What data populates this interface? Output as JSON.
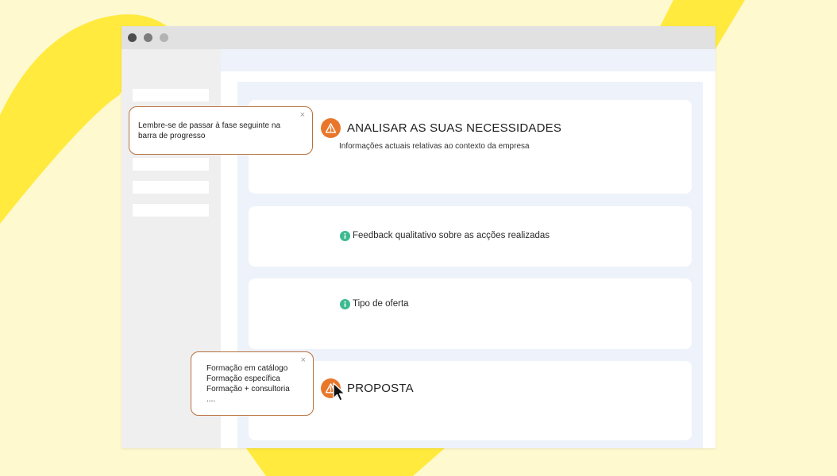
{
  "colors": {
    "background": "#fef9cf",
    "accent_yellow": "#ffea3d",
    "warning": "#e8772b",
    "info": "#3dba8f",
    "tooltip_border": "#b8703c",
    "content_bg": "#eef2fb"
  },
  "window": {
    "controls": [
      "close-dot",
      "minimize-dot",
      "maximize-dot"
    ]
  },
  "tooltips": {
    "progress_tip": {
      "text": "Lembre-se de passar à fase seguinte na barra de progresso",
      "close": "×"
    },
    "options_tip": {
      "lines": [
        "Formação em catálogo",
        "Formação específica",
        "Formação + consultoria",
        "...."
      ],
      "close": "×"
    }
  },
  "cards": {
    "analyse": {
      "icon": "warning-icon",
      "title": "ANALISAR AS SUAS NECESSIDADES",
      "subtitle": "Informações actuais relativas ao contexto da empresa"
    },
    "feedback": {
      "icon": "info-icon",
      "label": "Feedback qualitativo sobre as acções realizadas"
    },
    "offer": {
      "icon": "info-icon",
      "label": "Tipo de oferta"
    },
    "proposal": {
      "icon": "warning-icon",
      "title": "PROPOSTA"
    }
  }
}
